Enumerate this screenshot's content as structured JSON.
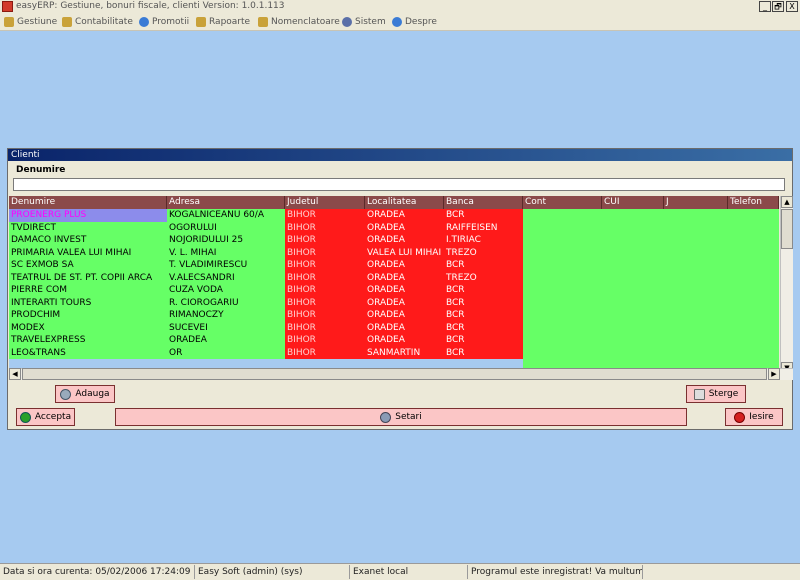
{
  "window": {
    "title": "easyERP: Gestiune, bonuri fiscale, clienti  Version: 1.0.1.113",
    "controls": [
      "_",
      "🗗",
      "X"
    ]
  },
  "menu": [
    {
      "label": "Gestiune",
      "icon": "folder-icon",
      "color": "#c9a23a"
    },
    {
      "label": "Contabilitate",
      "icon": "folder-icon",
      "color": "#c9a23a"
    },
    {
      "label": "Promotii",
      "icon": "promo-icon",
      "color": "#3a7bd5"
    },
    {
      "label": "Rapoarte",
      "icon": "report-icon",
      "color": "#c9a23a"
    },
    {
      "label": "Nomenclatoare",
      "icon": "list-icon",
      "color": "#c9a23a"
    },
    {
      "label": "Sistem",
      "icon": "gear-icon",
      "color": "#5a6fa8"
    },
    {
      "label": "Despre",
      "icon": "about-icon",
      "color": "#3a7bd5"
    }
  ],
  "clients": {
    "title": "Clienti",
    "search_label": "Denumire",
    "search_value": "",
    "columns": [
      "Denumire",
      "Adresa",
      "Judetul",
      "Localitatea",
      "Banca",
      "Cont",
      "CUI",
      "J",
      "Telefon"
    ],
    "rows": [
      [
        "PROENERG PLUS",
        "KOGALNICEANU 60/A",
        "BIHOR",
        "ORADEA",
        "BCR"
      ],
      [
        "TVDIRECT",
        "OGORULUI",
        "BIHOR",
        "ORADEA",
        "RAIFFEISEN"
      ],
      [
        "DAMACO INVEST",
        "NOJORIDULUI 25",
        "BIHOR",
        "ORADEA",
        "I.TIRIAC"
      ],
      [
        "PRIMARIA VALEA LUI MIHAI",
        "V. L. MIHAI",
        "BIHOR",
        "VALEA LUI MIHAI",
        "TREZO"
      ],
      [
        "SC EXMOB SA",
        "T. VLADIMIRESCU",
        "BIHOR",
        "ORADEA",
        "BCR"
      ],
      [
        "TEATRUL DE ST. PT. COPII ARCA",
        "V.ALECSANDRI",
        "BIHOR",
        "ORADEA",
        "TREZO"
      ],
      [
        "PIERRE COM",
        "CUZA VODA",
        "BIHOR",
        "ORADEA",
        "BCR"
      ],
      [
        "INTERARTI TOURS",
        "R. CIOROGARIU",
        "BIHOR",
        "ORADEA",
        "BCR"
      ],
      [
        "PRODCHIM",
        "RIMANOCZY",
        "BIHOR",
        "ORADEA",
        "BCR"
      ],
      [
        "MODEX",
        "SUCEVEI",
        "BIHOR",
        "ORADEA",
        "BCR"
      ],
      [
        "TRAVELEXPRESS",
        "ORADEA",
        "BIHOR",
        "ORADEA",
        "BCR"
      ],
      [
        "LEO&TRANS",
        "OR",
        "BIHOR",
        "SANMARTIN",
        "BCR"
      ]
    ],
    "buttons": {
      "add": "Adauga",
      "delete": "Sterge",
      "accept": "Accepta",
      "settings": "Setari",
      "exit": "Iesire"
    }
  },
  "status": [
    "Data si ora curenta: 05/02/2006 17:24:09",
    "Easy Soft (admin) (sys)",
    "Exanet local",
    "Programul este inregistrat! Va multumim.",
    ""
  ],
  "colors": {
    "desktop": "#a6caf0",
    "header": "#8b4a4a",
    "green": "#66ff66",
    "red": "#ff1a1a",
    "button": "#fbc6c6"
  }
}
